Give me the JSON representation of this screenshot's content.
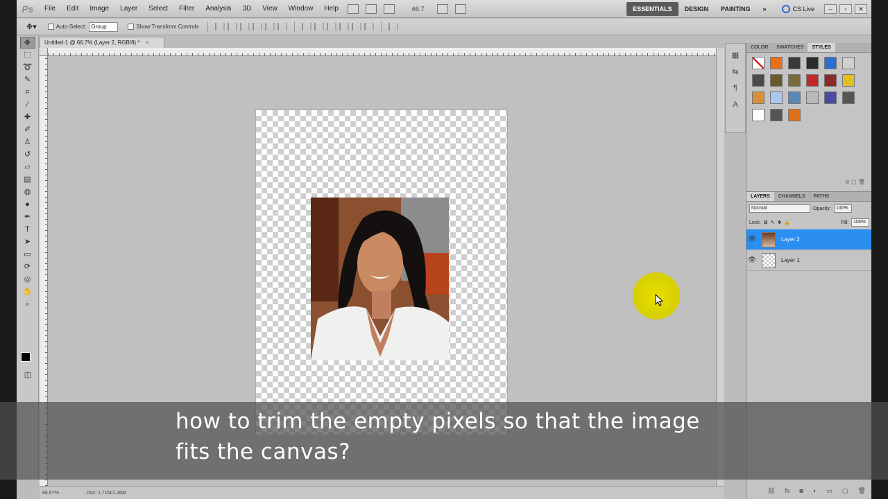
{
  "app": {
    "logo": "Ps",
    "menu": [
      "File",
      "Edit",
      "Image",
      "Layer",
      "Select",
      "Filter",
      "Analysis",
      "3D",
      "View",
      "Window",
      "Help"
    ],
    "zoom": "66.7",
    "workspaces": [
      "ESSENTIALS",
      "DESIGN",
      "PAINTING"
    ],
    "workspaces_more": "»",
    "cslive": "CS Live"
  },
  "options": {
    "auto_select_label": "Auto-Select:",
    "auto_select_value": "Group",
    "show_transform_label": "Show Transform Controls"
  },
  "document": {
    "tab_title": "Untitled-1 @ 66.7% (Layer 2, RGB/8) *",
    "status_zoom": "66.67%",
    "status_doc": "Doc: 1.71M/1.30M"
  },
  "panels": {
    "top_tabs": [
      "COLOR",
      "SWATCHES",
      "STYLES"
    ],
    "layers_tabs": [
      "LAYERS",
      "CHANNELS",
      "PATHS"
    ],
    "blend_mode": "Normal",
    "opacity_label": "Opacity:",
    "opacity_value": "100%",
    "lock_label": "Lock:",
    "fill_label": "Fill:",
    "fill_value": "100%",
    "layers": [
      {
        "name": "Layer 2",
        "selected": true
      },
      {
        "name": "Layer 1",
        "selected": false
      }
    ]
  },
  "styles_colors": [
    "#f4f4f4",
    "#e8701a",
    "#3a3a3a",
    "#2a2a2a",
    "#2a6fd0",
    "#d0d0d0",
    "#4a4a4a",
    "#6a5a2a",
    "#7a6a3a",
    "#c0282a",
    "#8a2a2a",
    "#e0c020",
    "#d8903a",
    "#a8c8f0",
    "#5a88b8",
    "#b8b8b8",
    "#4a4aa0",
    "#555555",
    "#ffffff",
    "#555555",
    "#e0701a"
  ],
  "subtitle": {
    "line1": "how to trim the empty pixels so that the image",
    "line2": "fits the canvas?"
  }
}
